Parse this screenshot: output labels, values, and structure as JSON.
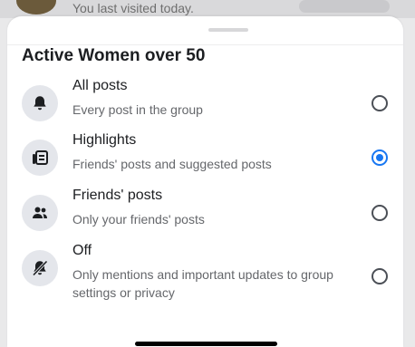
{
  "background": {
    "visited_text": "You last visited today."
  },
  "sheet": {
    "title": "Active Women over 50",
    "options": [
      {
        "label": "All posts",
        "description": "Every post in the group",
        "icon": "bell-icon",
        "selected": false
      },
      {
        "label": "Highlights",
        "description": "Friends' posts and suggested posts",
        "icon": "news-feed-icon",
        "selected": true
      },
      {
        "label": "Friends' posts",
        "description": "Only your friends' posts",
        "icon": "friends-icon",
        "selected": false
      },
      {
        "label": "Off",
        "description": "Only mentions and important updates to group settings or privacy",
        "icon": "bell-off-icon",
        "selected": false
      }
    ]
  },
  "colors": {
    "accent": "#1877f2",
    "text_primary": "#1c1e21",
    "text_secondary": "#65676b",
    "icon_bg": "#e4e6eb"
  }
}
